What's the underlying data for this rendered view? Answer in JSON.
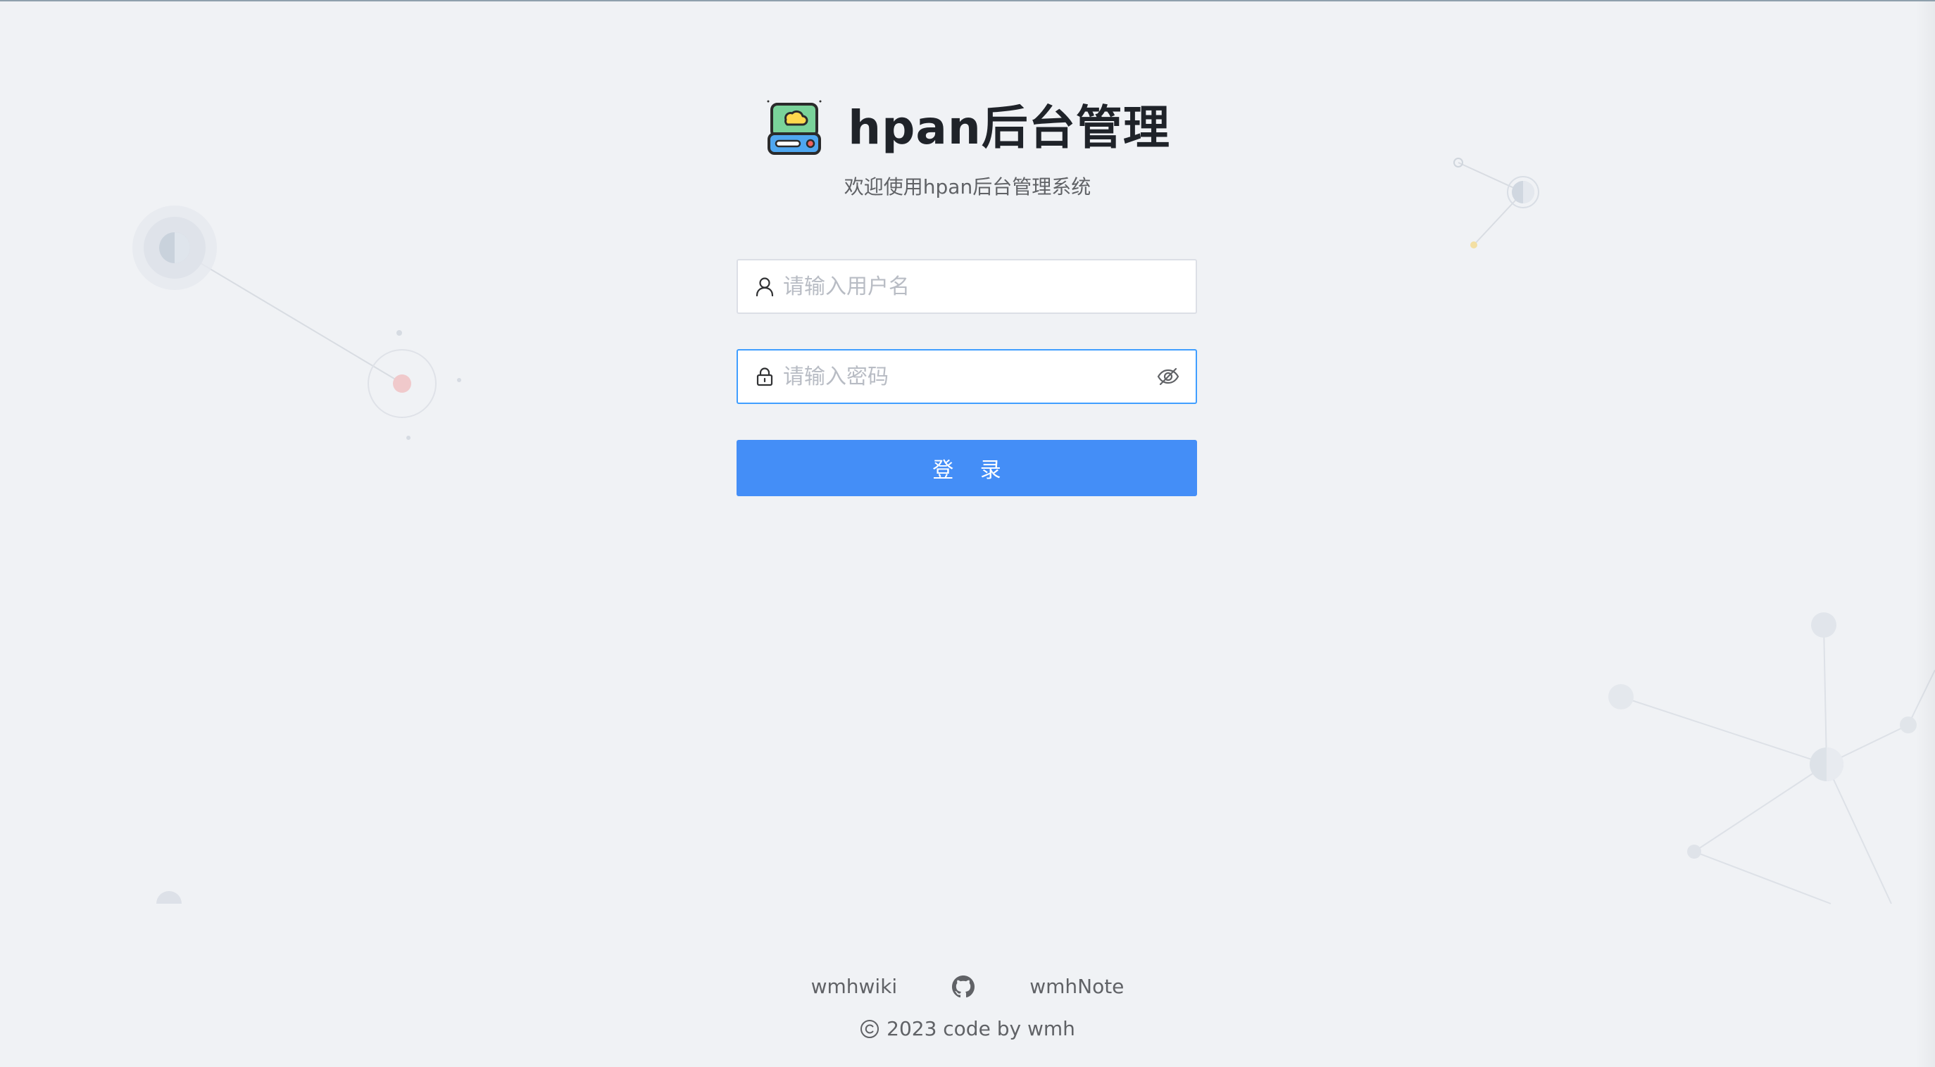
{
  "header": {
    "title": "hpan后台管理",
    "subtitle": "欢迎使用hpan后台管理系统"
  },
  "form": {
    "username": {
      "value": "",
      "placeholder": "请输入用户名"
    },
    "password": {
      "value": "",
      "placeholder": "请输入密码"
    },
    "login_label": "登 录"
  },
  "footer": {
    "links": [
      "wmhwiki",
      "wmhNote"
    ],
    "github_icon": "github-icon",
    "copyright": "2023 code by wmh"
  },
  "colors": {
    "background": "#f0f2f5",
    "primary": "#448ef7",
    "focus_border": "#409eff",
    "title": "#1f2329",
    "muted_text": "#606266"
  },
  "icons": [
    "app-logo",
    "user-icon",
    "lock-icon",
    "eye-hidden-icon",
    "github-icon",
    "copyright-icon"
  ]
}
